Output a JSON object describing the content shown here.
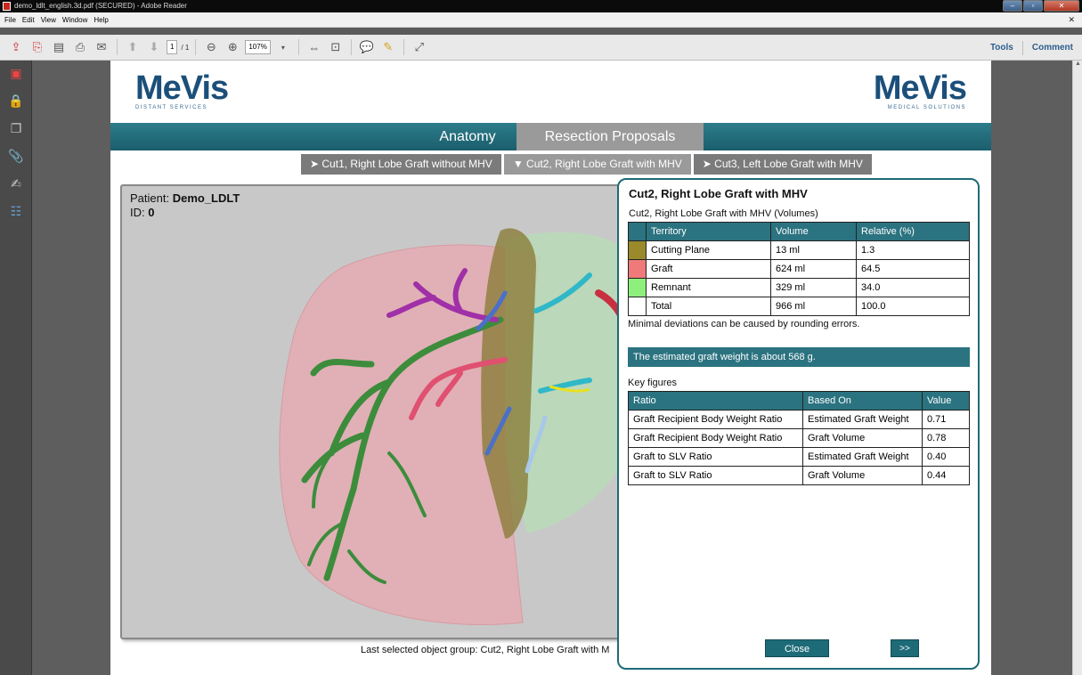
{
  "window": {
    "title": "demo_ldlt_english.3d.pdf (SECURED) - Adobe Reader"
  },
  "menu": [
    "File",
    "Edit",
    "View",
    "Window",
    "Help"
  ],
  "toolbar": {
    "page_current": "1",
    "page_total": "/ 1",
    "zoom": "107%",
    "tools": "Tools",
    "comment": "Comment"
  },
  "header": {
    "logo_left": "MeVis",
    "logo_left_sub": "DISTANT SERVICES",
    "logo_right": "MeVis",
    "logo_right_sub": "MEDICAL SOLUTIONS"
  },
  "tabs": {
    "anatomy": "Anatomy",
    "resection": "Resection Proposals"
  },
  "subtabs": [
    "➤ Cut1, Right Lobe Graft without MHV",
    "▼ Cut2, Right Lobe Graft with MHV",
    "➤ Cut3, Left Lobe Graft with MHV"
  ],
  "patient": {
    "label": "Patient: ",
    "name": "Demo_LDLT",
    "id_label": "ID: ",
    "id": "0"
  },
  "last_selected": "Last selected object group:  Cut2, Right Lobe Graft with M",
  "popup": {
    "title": "Cut2, Right Lobe Graft with MHV",
    "subtitle": "Cut2, Right Lobe Graft with MHV (Volumes)",
    "vol_headers": [
      "Territory",
      "Volume",
      "Relative (%)"
    ],
    "vol_rows": [
      {
        "color": "#9a8a2c",
        "territory": "Cutting Plane",
        "volume": "13 ml",
        "relative": "1.3"
      },
      {
        "color": "#f07a7a",
        "territory": "Graft",
        "volume": "624 ml",
        "relative": "64.5"
      },
      {
        "color": "#8ef07c",
        "territory": "Remnant",
        "volume": "329 ml",
        "relative": "34.0"
      },
      {
        "color": "#ffffff",
        "territory": "Total",
        "volume": "966 ml",
        "relative": "100.0"
      }
    ],
    "note": "Minimal deviations can be caused by rounding errors.",
    "estimate": "The estimated graft weight is about 568 g.",
    "key_figures_label": "Key figures",
    "kf_headers": [
      "Ratio",
      "Based On",
      "Value"
    ],
    "kf_rows": [
      {
        "ratio": "Graft Recipient Body Weight Ratio",
        "based": "Estimated Graft Weight",
        "value": "0.71"
      },
      {
        "ratio": "Graft Recipient Body Weight Ratio",
        "based": "Graft Volume",
        "value": "0.78"
      },
      {
        "ratio": "Graft to SLV Ratio",
        "based": "Estimated Graft Weight",
        "value": "0.40"
      },
      {
        "ratio": "Graft to SLV Ratio",
        "based": "Graft Volume",
        "value": "0.44"
      }
    ],
    "close": "Close",
    "next": ">>"
  }
}
